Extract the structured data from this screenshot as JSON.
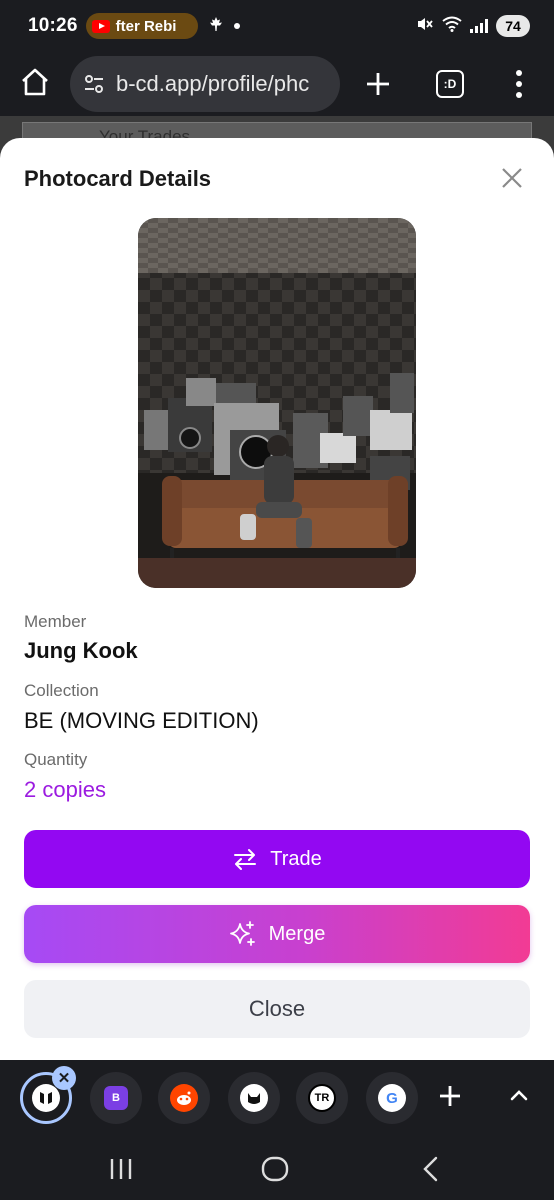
{
  "status_bar": {
    "time": "10:26",
    "media_text": "fter Rebi",
    "battery": "74",
    "icons": [
      "youtube-icon",
      "maple-leaf-icon",
      "notification-dot-icon",
      "mute-icon",
      "wifi-icon",
      "signal-icon"
    ]
  },
  "browser": {
    "url": "b-cd.app/profile/phc",
    "tabs_label": ":D"
  },
  "behind": {
    "title": "Your Trades"
  },
  "modal": {
    "title": "Photocard Details",
    "member_label": "Member",
    "member_value": "Jung Kook",
    "collection_label": "Collection",
    "collection_value": "BE (MOVING EDITION)",
    "quantity_label": "Quantity",
    "quantity_value": "2 copies",
    "trade_label": "Trade",
    "merge_label": "Merge",
    "close_label": "Close",
    "colors": {
      "trade": "#9308f2",
      "merge_start": "#a64af5",
      "merge_end": "#f23b94",
      "quantity": "#9b1be0"
    }
  },
  "tab_strip": {
    "tabs": [
      {
        "favicon": "BTS"
      },
      {
        "favicon": "B"
      },
      {
        "favicon": "reddit"
      },
      {
        "favicon": "cat"
      },
      {
        "favicon": "TR"
      },
      {
        "favicon": "G"
      }
    ]
  }
}
